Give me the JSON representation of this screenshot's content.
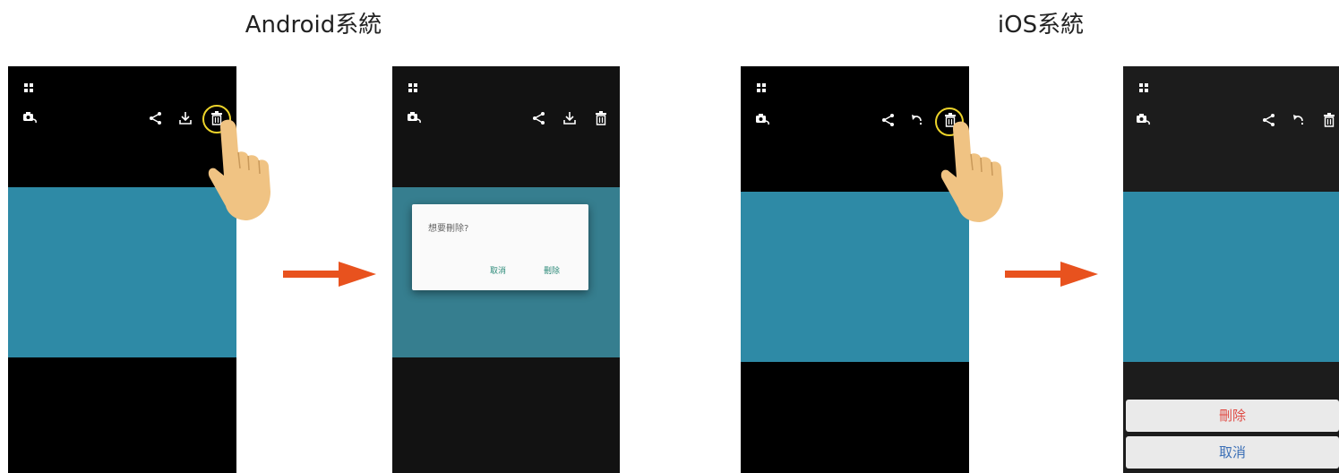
{
  "headings": {
    "android": "Android系統",
    "ios": "iOS系統"
  },
  "android_dialog": {
    "question": "想要刪除?",
    "cancel_label": "取消",
    "delete_label": "刪除"
  },
  "ios_sheet": {
    "delete_label": "刪除",
    "cancel_label": "取消"
  },
  "icons": {
    "grid": "grid-icon",
    "camera_switch": "camera-switch-icon",
    "share": "share-icon",
    "download": "download-icon",
    "rotate": "rotate-icon",
    "trash": "trash-icon",
    "arrow": "arrow-right-icon",
    "hand": "hand-pointer-icon"
  },
  "colors": {
    "phone_black": "#000000",
    "phone_dark": "#121212",
    "photo_teal": "#2e8aa6",
    "photo_teal_dimmed": "#367e8f",
    "highlight_ring": "#ecd32a",
    "arrow_orange": "#e8521e",
    "dialog_button": "#2e8b7a",
    "sheet_delete": "#e04a43",
    "sheet_cancel": "#3b6fb6"
  }
}
